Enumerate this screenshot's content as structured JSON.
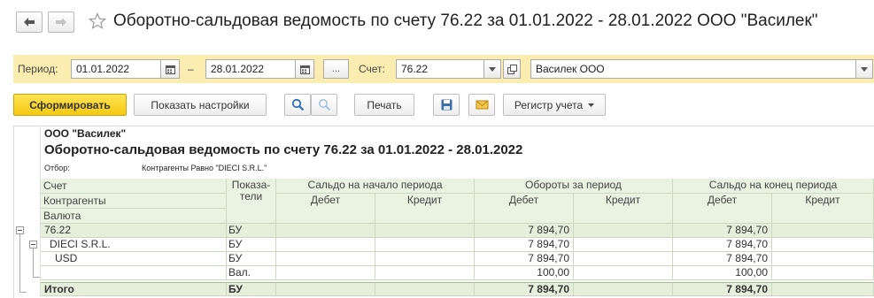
{
  "window": {
    "title": "Оборотно-сальдовая ведомость по счету 76.22 за 01.01.2022 - 28.01.2022 ООО \"Василек\""
  },
  "filters": {
    "period_label": "Период:",
    "date_from": "01.01.2022",
    "dash": "–",
    "date_to": "28.01.2022",
    "more_button": "...",
    "account_label": "Счет:",
    "account_value": "76.22",
    "organization_value": "Василек ООО"
  },
  "toolbar": {
    "generate": "Сформировать",
    "show_settings": "Показать настройки",
    "print": "Печать",
    "register": "Регистр учета"
  },
  "report": {
    "org_name": "ООО \"Василек\"",
    "heading": "Оборотно-сальдовая ведомость по счету 76.22 за 01.01.2022 - 28.01.2022",
    "filter_label": "Отбор:",
    "filter_value": "Контрагенты Равно \"DIECI S.R.L.\"",
    "headers": {
      "account": "Счет",
      "counterparties": "Контрагенты",
      "currency": "Валюта",
      "indicators": "Показа-\nтели",
      "opening_balance": "Сальдо на начало периода",
      "turnover": "Обороты за период",
      "closing_balance": "Сальдо на конец периода",
      "debit": "Дебет",
      "credit": "Кредит"
    },
    "rows": [
      {
        "name": "76.22",
        "indicator": "БУ",
        "open_debit": "",
        "open_credit": "",
        "turn_debit": "7 894,70",
        "turn_credit": "",
        "close_debit": "7 894,70",
        "close_credit": ""
      },
      {
        "name": "DIECI S.R.L.",
        "indicator": "БУ",
        "open_debit": "",
        "open_credit": "",
        "turn_debit": "7 894,70",
        "turn_credit": "",
        "close_debit": "7 894,70",
        "close_credit": ""
      },
      {
        "name": "USD",
        "indicator": "БУ",
        "open_debit": "",
        "open_credit": "",
        "turn_debit": "7 894,70",
        "turn_credit": "",
        "close_debit": "7 894,70",
        "close_credit": ""
      },
      {
        "name": "",
        "indicator": "Вал.",
        "open_debit": "",
        "open_credit": "",
        "turn_debit": "100,00",
        "turn_credit": "",
        "close_debit": "100,00",
        "close_credit": ""
      }
    ],
    "total": {
      "name": "Итого",
      "indicator": "БУ",
      "turn_debit": "7 894,70",
      "close_debit": "7 894,70"
    }
  }
}
